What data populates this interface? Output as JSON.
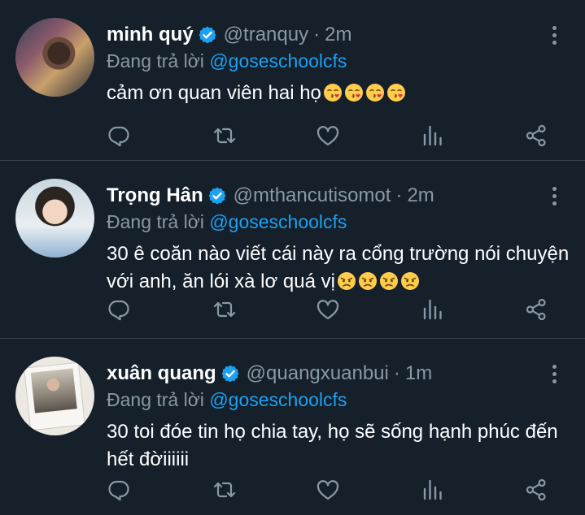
{
  "tweets": [
    {
      "name": "minh quý",
      "handle": "@tranquy",
      "separator": "·",
      "time": "2m",
      "reply_prefix": "Đang trả lời",
      "reply_to": "@goseschoolcfs",
      "text": "cảm ơn quan viên hai họ",
      "emoji": [
        "kissing-heart",
        "kissing-heart",
        "kissing-heart",
        "kissing-heart"
      ]
    },
    {
      "name": "Trọng Hân",
      "handle": "@mthancutisomot",
      "separator": "·",
      "time": "2m",
      "reply_prefix": "Đang trả lời",
      "reply_to": "@goseschoolcfs",
      "text": "30 ê coăn nào viết cái này ra cổng trường nói chuyện với anh, ăn lói xà lơ quá vị",
      "emoji": [
        "angry-face",
        "angry-face",
        "angry-face",
        "angry-face"
      ]
    },
    {
      "name": "xuân quang",
      "handle": "@quangxuanbui",
      "separator": "·",
      "time": "1m",
      "reply_prefix": "Đang trả lời",
      "reply_to": "@goseschoolcfs",
      "text": "30 toi đóe tin họ chia tay, họ sẽ sống hạnh phúc đến hết đờiiiiii",
      "emoji": []
    }
  ],
  "icons": {
    "verified": "verified-badge-icon",
    "more": "more-vertical-icon",
    "reply": "reply-icon",
    "retweet": "retweet-icon",
    "like": "heart-icon",
    "stats": "analytics-icon",
    "share": "share-icon"
  },
  "colors": {
    "background": "#15202b",
    "divider": "#38444d",
    "muted": "#8899a6",
    "accent": "#1da1f2",
    "text": "#ffffff"
  }
}
